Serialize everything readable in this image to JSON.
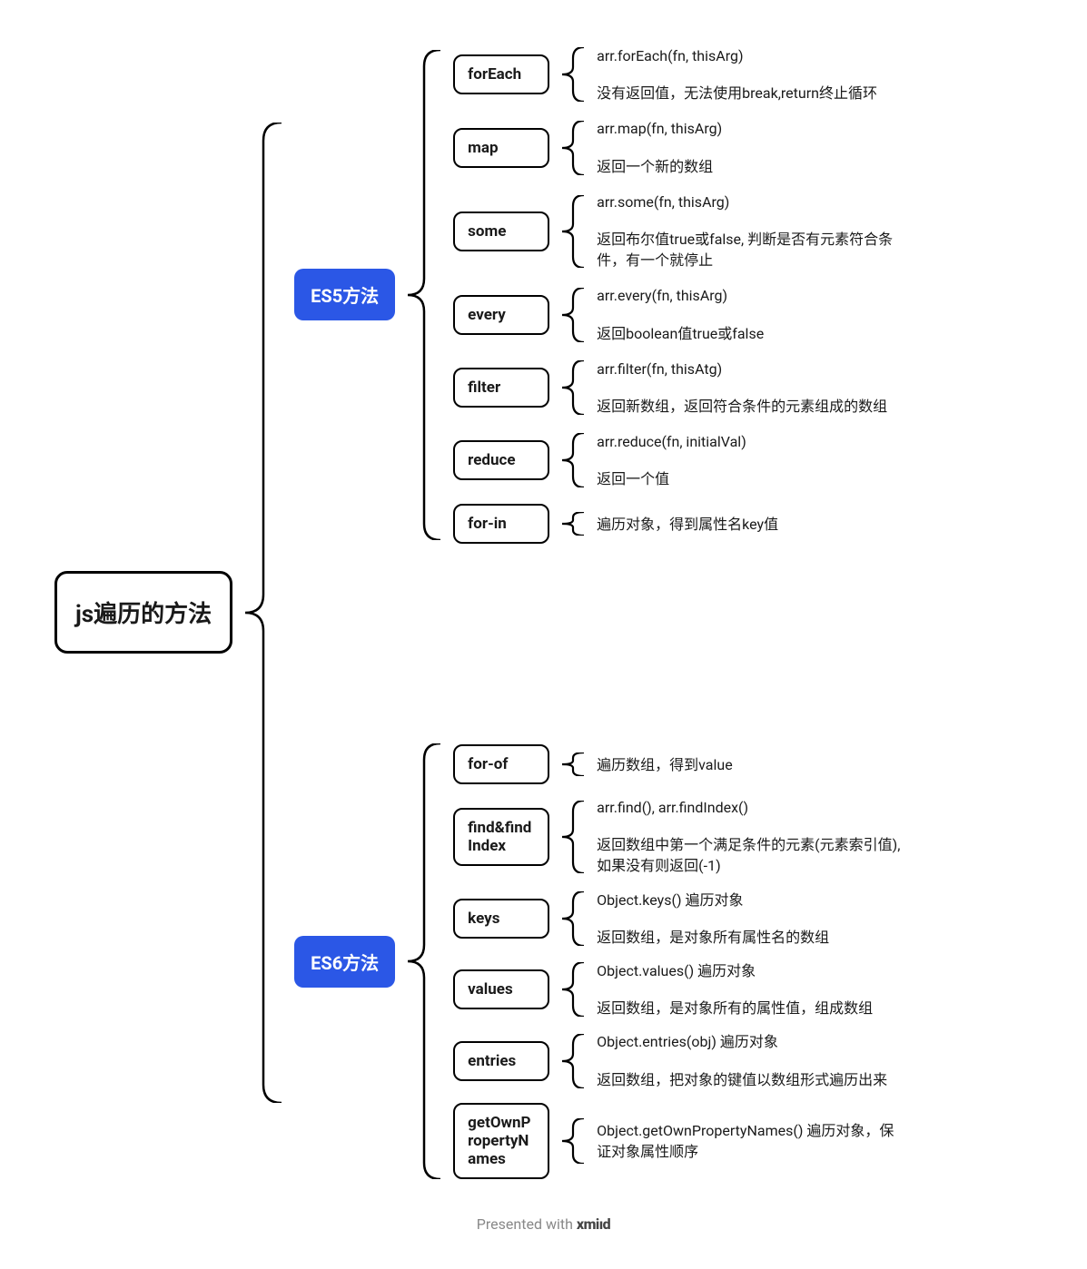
{
  "root": "js遍历的方法",
  "categories": [
    {
      "label": "ES5方法",
      "methods": [
        {
          "label": "forEach",
          "leaves": [
            "arr.forEach(fn, thisArg)",
            "没有返回值，无法使用break,return终止循环"
          ]
        },
        {
          "label": "map",
          "leaves": [
            "arr.map(fn, thisArg)",
            "返回一个新的数组"
          ]
        },
        {
          "label": "some",
          "leaves": [
            "arr.some(fn, thisArg)",
            "返回布尔值true或false, 判断是否有元素符合条件，有一个就停止"
          ]
        },
        {
          "label": "every",
          "leaves": [
            "arr.every(fn, thisArg)",
            "返回boolean值true或false"
          ]
        },
        {
          "label": "filter",
          "leaves": [
            "arr.filter(fn, thisAtg)",
            "返回新数组，返回符合条件的元素组成的数组"
          ]
        },
        {
          "label": "reduce",
          "leaves": [
            "arr.reduce(fn, initialVal)",
            "返回一个值"
          ]
        },
        {
          "label": "for-in",
          "leaves": [
            "遍历对象，得到属性名key值"
          ]
        }
      ]
    },
    {
      "label": "ES6方法",
      "methods": [
        {
          "label": "for-of",
          "leaves": [
            "遍历数组，得到value"
          ]
        },
        {
          "label": "find&findIndex",
          "leaves": [
            "arr.find(), arr.findIndex()",
            "返回数组中第一个满足条件的元素(元素索引值), 如果没有则返回(-1)"
          ]
        },
        {
          "label": "keys",
          "leaves": [
            "Object.keys() 遍历对象",
            "返回数组，是对象所有属性名的数组"
          ]
        },
        {
          "label": "values",
          "leaves": [
            "Object.values() 遍历对象",
            "返回数组，是对象所有的属性值，组成数组"
          ]
        },
        {
          "label": "entries",
          "leaves": [
            "Object.entries(obj) 遍历对象",
            "返回数组，把对象的键值以数组形式遍历出来"
          ]
        },
        {
          "label": "getOwnPropertyNames",
          "leaves": [
            "Object.getOwnPropertyNames() 遍历对象，保证对象属性顺序"
          ]
        }
      ]
    }
  ],
  "footer": {
    "prefix": "Presented with ",
    "logo": "xmiıd"
  }
}
